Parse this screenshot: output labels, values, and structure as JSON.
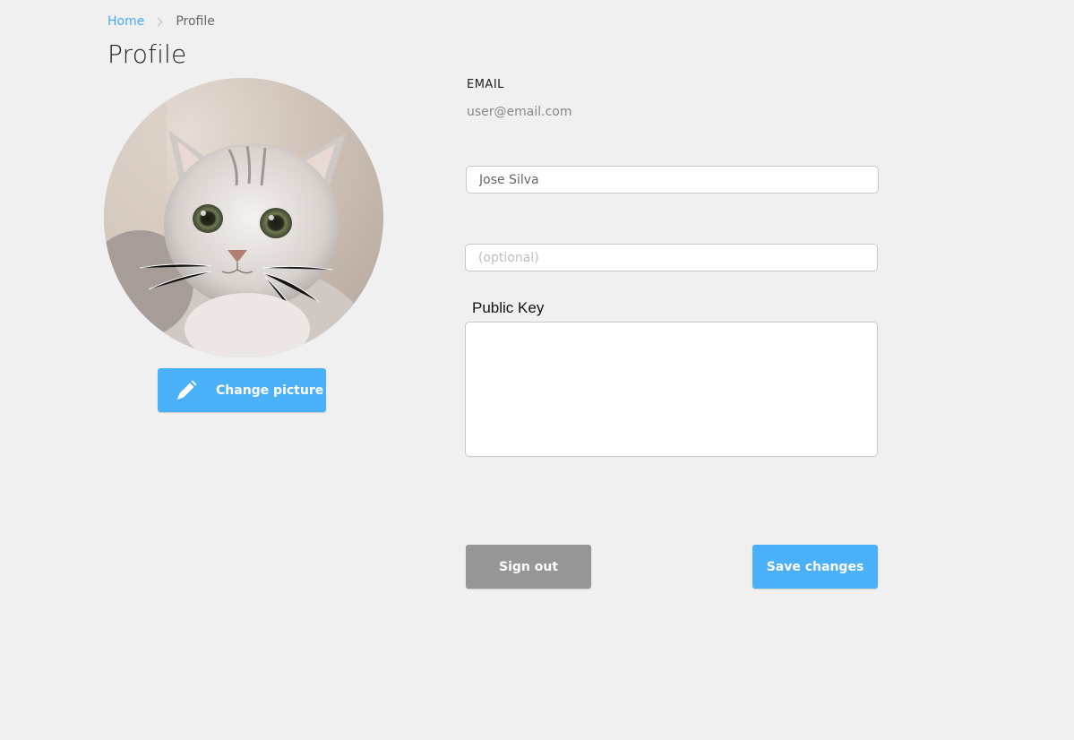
{
  "breadcrumb": {
    "home_label": "Home",
    "current_label": "Profile"
  },
  "page_title": "Profile",
  "avatar": {
    "change_label": "Change picture",
    "icon": "pencil-icon"
  },
  "email": {
    "label": "EMAIL",
    "value": "user@email.com"
  },
  "name_field": {
    "value": "Jose Silva"
  },
  "optional_field": {
    "placeholder": "(optional)",
    "value": ""
  },
  "public_key": {
    "label": "Public Key",
    "value": ""
  },
  "actions": {
    "signout_label": "Sign out",
    "save_label": "Save changes"
  },
  "colors": {
    "accent": "#4ab0f7",
    "link": "#4aabf5",
    "secondary_button": "#969696",
    "background": "#f0f0f0"
  }
}
